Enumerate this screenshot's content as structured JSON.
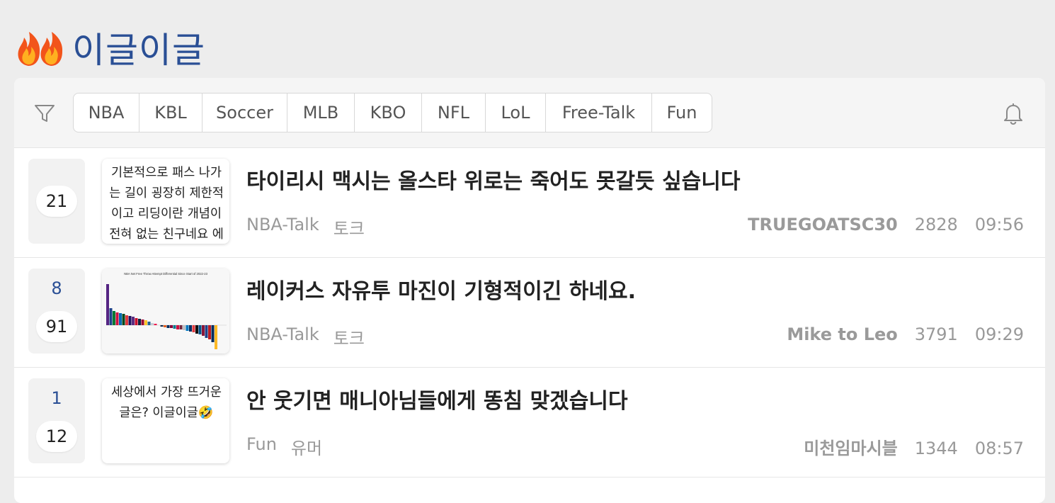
{
  "header": {
    "title": "이글이글",
    "icon": "fire-icon"
  },
  "filter": {
    "icon": "filter-icon",
    "tabs": [
      "NBA",
      "KBL",
      "Soccer",
      "MLB",
      "KBO",
      "NFL",
      "LoL",
      "Free-Talk",
      "Fun"
    ],
    "bell_icon": "bell-icon"
  },
  "colors": {
    "accent": "#2a4f95",
    "background": "#ededed",
    "meta_text": "#999999"
  },
  "posts": [
    {
      "likes": "",
      "comments": "21",
      "thumb_text": "기본적으로 패스 나가는 길이 굉장히 제한적이고 리딩이란 개념이 전혀 없는 친구네요 에",
      "title": "타이리시 맥시는 올스타 위로는 죽어도 못갈듯 싶습니다",
      "board": "NBA-Talk",
      "category": "토크",
      "author": "TRUEGOATSC30",
      "views": "2828",
      "time": "09:56"
    },
    {
      "likes": "8",
      "comments": "91",
      "thumb_chart_title": "NBA Net Free Throw Attempt Differential Since Start of 2022-23",
      "title": "레이커스 자유투 마진이 기형적이긴 하네요.",
      "board": "NBA-Talk",
      "category": "토크",
      "author": "Mike to Leo",
      "views": "3791",
      "time": "09:29"
    },
    {
      "likes": "1",
      "comments": "12",
      "thumb_text": "세상에서 가장 뜨거운 글은? 이글이글🤣",
      "title": "안 웃기면 매니아님들에게 똥침 맞겠습니다",
      "board": "Fun",
      "category": "유머",
      "author": "미천임마시블",
      "views": "1344",
      "time": "08:57"
    }
  ]
}
